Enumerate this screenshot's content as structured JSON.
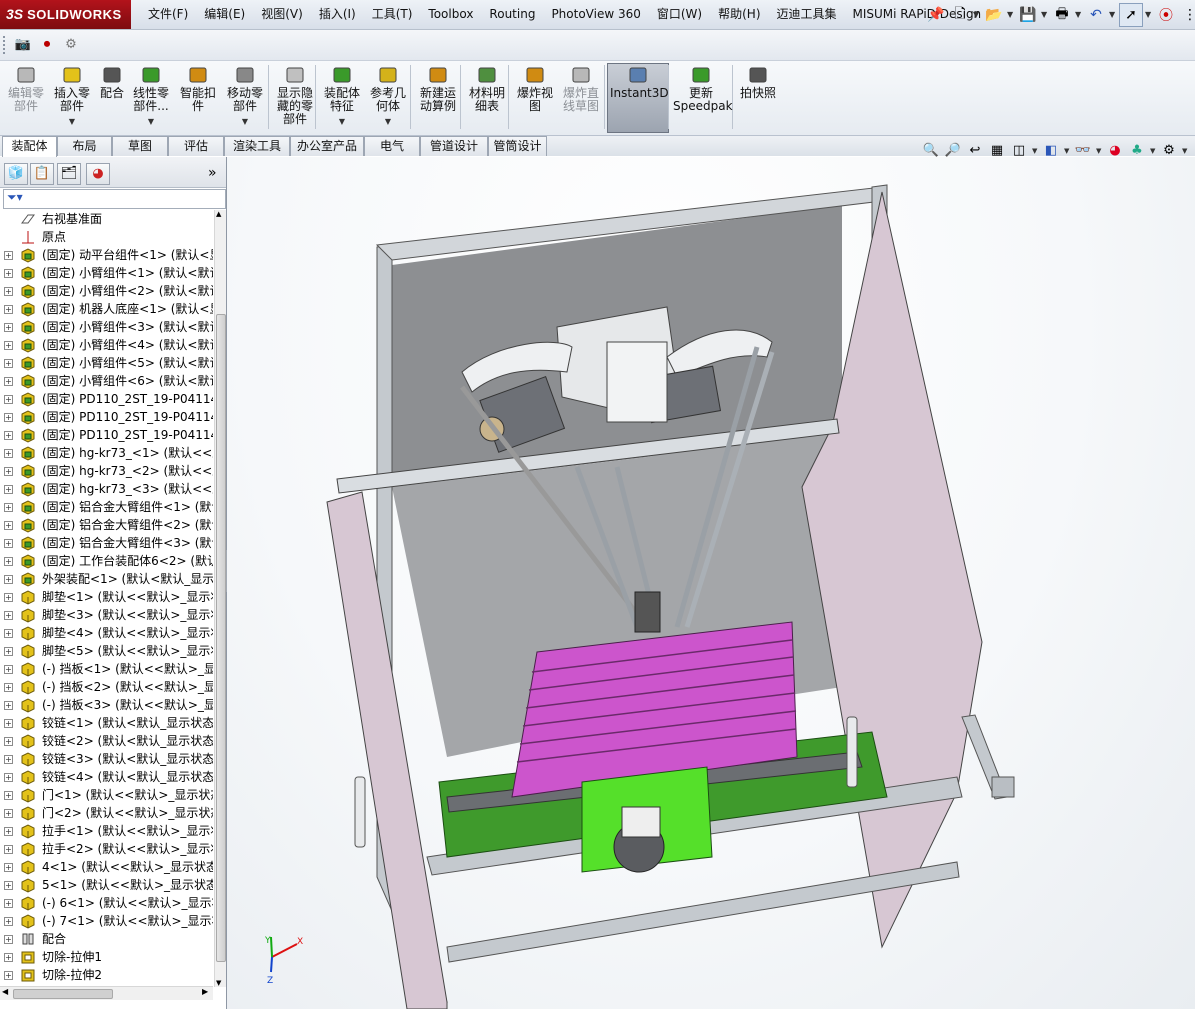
{
  "app": {
    "logo_text": "SOLIDWORKS",
    "logo_prefix": "3S"
  },
  "menus": [
    "文件(F)",
    "编辑(E)",
    "视图(V)",
    "插入(I)",
    "工具(T)",
    "Toolbox",
    "Routing",
    "PhotoView 360",
    "窗口(W)",
    "帮助(H)",
    "迈迪工具集",
    "MISUMi RAPiD Design"
  ],
  "command_manager": {
    "buttons": [
      {
        "label": "编辑零\n部件",
        "icon": "edit-component-icon",
        "enabled": false
      },
      {
        "label": "插入零\n部件",
        "icon": "insert-component-icon",
        "enabled": true
      },
      {
        "label": "配合",
        "icon": "mate-icon",
        "enabled": true
      },
      {
        "label": "线性零\n部件...",
        "icon": "linear-pattern-icon",
        "enabled": true
      },
      {
        "label": "智能扣\n件",
        "icon": "smart-fastener-icon",
        "enabled": true
      },
      {
        "label": "移动零\n部件",
        "icon": "move-component-icon",
        "enabled": true
      },
      {
        "label": "显示隐\n藏的零\n部件",
        "icon": "show-hidden-icon",
        "enabled": true
      },
      {
        "label": "装配体\n特征",
        "icon": "assembly-feature-icon",
        "enabled": true
      },
      {
        "label": "参考几\n何体",
        "icon": "reference-geometry-icon",
        "enabled": true
      },
      {
        "label": "新建运\n动算例",
        "icon": "motion-study-icon",
        "enabled": true
      },
      {
        "label": "材料明\n细表",
        "icon": "bom-icon",
        "enabled": true
      },
      {
        "label": "爆炸视\n图",
        "icon": "exploded-view-icon",
        "enabled": true
      },
      {
        "label": "爆炸直\n线草图",
        "icon": "explode-line-icon",
        "enabled": false
      },
      {
        "label": "Instant3D",
        "icon": "instant3d-icon",
        "enabled": true
      },
      {
        "label": "更新\nSpeedpak",
        "icon": "speedpak-icon",
        "enabled": true
      },
      {
        "label": "拍快照",
        "icon": "snapshot-icon",
        "enabled": true
      }
    ]
  },
  "tabs": [
    "装配体",
    "布局",
    "草图",
    "评估",
    "渲染工具",
    "办公室产品",
    "电气",
    "管道设计",
    "管筒设计"
  ],
  "feature_tree": {
    "items": [
      {
        "label": "右视基准面",
        "icon": "plane-icon",
        "expand": false
      },
      {
        "label": "原点",
        "icon": "origin-icon",
        "expand": false
      },
      {
        "label": "(固定) 动平台组件<1> (默认<显",
        "icon": "subassembly-icon",
        "expand": true
      },
      {
        "label": "(固定) 小臂组件<1> (默认<默认",
        "icon": "subassembly-icon",
        "expand": true
      },
      {
        "label": "(固定) 小臂组件<2> (默认<默认",
        "icon": "subassembly-icon",
        "expand": true
      },
      {
        "label": "(固定) 机器人底座<1> (默认<显",
        "icon": "subassembly-icon",
        "expand": true
      },
      {
        "label": "(固定) 小臂组件<3> (默认<默认",
        "icon": "subassembly-icon",
        "expand": true
      },
      {
        "label": "(固定) 小臂组件<4> (默认<默认",
        "icon": "subassembly-icon",
        "expand": true
      },
      {
        "label": "(固定) 小臂组件<5> (默认<默认",
        "icon": "subassembly-icon",
        "expand": true
      },
      {
        "label": "(固定) 小臂组件<6> (默认<默认",
        "icon": "subassembly-icon",
        "expand": true
      },
      {
        "label": "(固定) PD110_2ST_19-P041140",
        "icon": "subassembly-icon",
        "expand": true
      },
      {
        "label": "(固定) PD110_2ST_19-P041140",
        "icon": "subassembly-icon",
        "expand": true
      },
      {
        "label": "(固定) PD110_2ST_19-P041140",
        "icon": "subassembly-icon",
        "expand": true
      },
      {
        "label": "(固定) hg-kr73_<1> (默认<<显",
        "icon": "subassembly-icon",
        "expand": true
      },
      {
        "label": "(固定) hg-kr73_<2> (默认<<显",
        "icon": "subassembly-icon",
        "expand": true
      },
      {
        "label": "(固定) hg-kr73_<3> (默认<<显",
        "icon": "subassembly-icon",
        "expand": true
      },
      {
        "label": "(固定) 铝合金大臂组件<1> (默认",
        "icon": "subassembly-icon",
        "expand": true
      },
      {
        "label": "(固定) 铝合金大臂组件<2> (默认",
        "icon": "subassembly-icon",
        "expand": true
      },
      {
        "label": "(固定) 铝合金大臂组件<3> (默认",
        "icon": "subassembly-icon",
        "expand": true
      },
      {
        "label": "(固定) 工作台装配体6<2> (默认",
        "icon": "subassembly-icon",
        "expand": true
      },
      {
        "label": "外架装配<1> (默认<默认_显示",
        "icon": "subassembly-icon",
        "expand": true
      },
      {
        "label": "脚垫<1> (默认<<默认>_显示状",
        "icon": "part-icon",
        "expand": true
      },
      {
        "label": "脚垫<3> (默认<<默认>_显示状",
        "icon": "part-icon",
        "expand": true
      },
      {
        "label": "脚垫<4> (默认<<默认>_显示状",
        "icon": "part-icon",
        "expand": true
      },
      {
        "label": "脚垫<5> (默认<<默认>_显示状",
        "icon": "part-icon",
        "expand": true
      },
      {
        "label": "(-) 挡板<1> (默认<<默认>_显示",
        "icon": "part-icon",
        "expand": true
      },
      {
        "label": "(-) 挡板<2> (默认<<默认>_显示",
        "icon": "part-icon",
        "expand": true
      },
      {
        "label": "(-) 挡板<3> (默认<<默认>_显示",
        "icon": "part-icon",
        "expand": true
      },
      {
        "label": "铰链<1> (默认<默认_显示状态-",
        "icon": "part-icon",
        "expand": true
      },
      {
        "label": "铰链<2> (默认<默认_显示状态-",
        "icon": "part-icon",
        "expand": true
      },
      {
        "label": "铰链<3> (默认<默认_显示状态-",
        "icon": "part-icon",
        "expand": true
      },
      {
        "label": "铰链<4> (默认<默认_显示状态-",
        "icon": "part-icon",
        "expand": true
      },
      {
        "label": "门<1> (默认<<默认>_显示状态",
        "icon": "part-icon",
        "expand": true
      },
      {
        "label": "门<2> (默认<<默认>_显示状态",
        "icon": "part-icon",
        "expand": true
      },
      {
        "label": "拉手<1> (默认<<默认>_显示状",
        "icon": "part-icon",
        "expand": true
      },
      {
        "label": "拉手<2> (默认<<默认>_显示状",
        "icon": "part-icon",
        "expand": true
      },
      {
        "label": "4<1> (默认<<默认>_显示状态",
        "icon": "part-icon",
        "expand": true
      },
      {
        "label": "5<1> (默认<<默认>_显示状态",
        "icon": "part-icon",
        "expand": true
      },
      {
        "label": "(-) 6<1> (默认<<默认>_显示状",
        "icon": "part-icon",
        "expand": true
      },
      {
        "label": "(-) 7<1> (默认<<默认>_显示状",
        "icon": "part-icon",
        "expand": true
      },
      {
        "label": "配合",
        "icon": "mates-folder-icon",
        "expand": true
      },
      {
        "label": "切除-拉伸1",
        "icon": "cut-extrude-icon",
        "expand": true
      },
      {
        "label": "切除-拉伸2",
        "icon": "cut-extrude-icon",
        "expand": true
      }
    ]
  },
  "colors": {
    "accent_red": "#b3131b",
    "tree_icon_yellow": "#e3c21a",
    "tree_icon_green": "#3a9a2a",
    "enclosure_panel": "#d7c7d3",
    "table_magenta": "#cc55cc",
    "rail_green": "#3f9a2c",
    "frame_grey": "#c4c9ce"
  },
  "triad": {
    "x": "X",
    "y": "Y",
    "z": "Z"
  }
}
